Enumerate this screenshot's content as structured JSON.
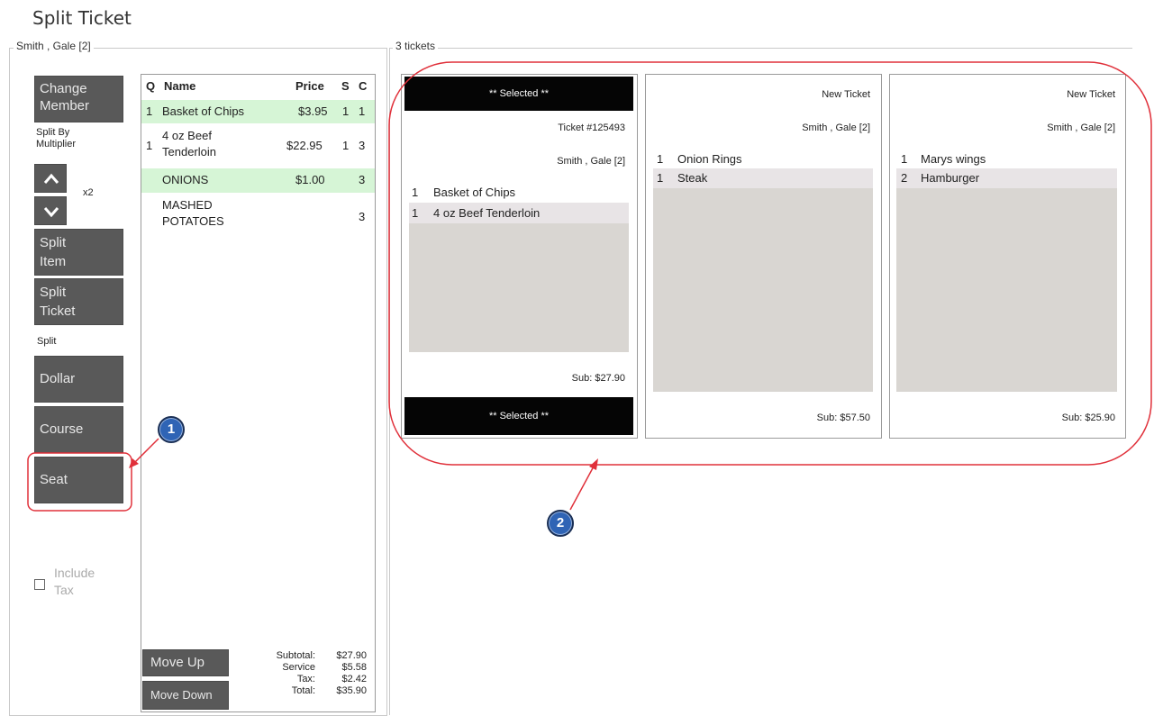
{
  "title": "Split Ticket",
  "left_group_label": "Smith , Gale [2]",
  "right_group_label": "3 tickets",
  "buttons": {
    "change_member_line1": "Change",
    "change_member_line2": "Member",
    "split_item_line1": "Split",
    "split_item_line2": "Item",
    "split_ticket_line1": "Split",
    "split_ticket_line2": "Ticket",
    "dollar": "Dollar",
    "course": "Course",
    "seat": "Seat",
    "move_up": "Move Up",
    "move_down": "Move Down"
  },
  "split_by_label_line1": "Split By",
  "split_by_label_line2": "Multiplier",
  "multiplier_value": "x2",
  "split_label": "Split",
  "include_tax_line1": "Include",
  "include_tax_line2": "Tax",
  "items_table": {
    "headers": {
      "q": "Q",
      "name": "Name",
      "price": "Price",
      "s": "S",
      "c": "C"
    },
    "rows": [
      {
        "q": "1",
        "name": "Basket of Chips",
        "price": "$3.95",
        "s": "1",
        "c": "1"
      },
      {
        "q": "1",
        "name_line1": "4 oz Beef",
        "name_line2": "Tenderloin",
        "price": "$22.95",
        "s": "1",
        "c": "3"
      },
      {
        "q": "",
        "name": "ONIONS",
        "price": "$1.00",
        "s": "",
        "c": "3"
      },
      {
        "q": "",
        "name_line1": "MASHED",
        "name_line2": "POTATOES",
        "price": "",
        "s": "",
        "c": "3"
      }
    ]
  },
  "totals": {
    "subtotal_label": "Subtotal:",
    "subtotal": "$27.90",
    "service_label": "Service",
    "service": "$5.58",
    "tax_label": "Tax:",
    "tax": "$2.42",
    "total_label": "Total:",
    "total": "$35.90"
  },
  "tickets": [
    {
      "selected_label": "** Selected **",
      "ticket_no": "Ticket #125493",
      "member": "Smith , Gale [2]",
      "items": [
        {
          "qty": "1",
          "name": "Basket of Chips"
        },
        {
          "qty": "1",
          "name": "4 oz Beef Tenderloin"
        }
      ],
      "sub": "Sub: $27.90",
      "selected_footer": "** Selected **"
    },
    {
      "header": "New Ticket",
      "member": "Smith , Gale [2]",
      "items": [
        {
          "qty": "1",
          "name": "Onion Rings"
        },
        {
          "qty": "1",
          "name": "Steak"
        }
      ],
      "sub": "Sub: $57.50"
    },
    {
      "header": "New Ticket",
      "member": "Smith , Gale [2]",
      "items": [
        {
          "qty": "1",
          "name": "Marys wings"
        },
        {
          "qty": "2",
          "name": "Hamburger"
        }
      ],
      "sub": "Sub: $25.90"
    }
  ],
  "callouts": {
    "one": "1",
    "two": "2"
  },
  "colors": {
    "annotation_red": "#e0303a",
    "button_dark": "#595959",
    "highlight_green": "#d6f5d6",
    "callout_blue": "#2f64b5"
  },
  "icons": {
    "up": "chevron-up-icon",
    "down": "chevron-down-icon",
    "checkbox": "checkbox-icon"
  }
}
